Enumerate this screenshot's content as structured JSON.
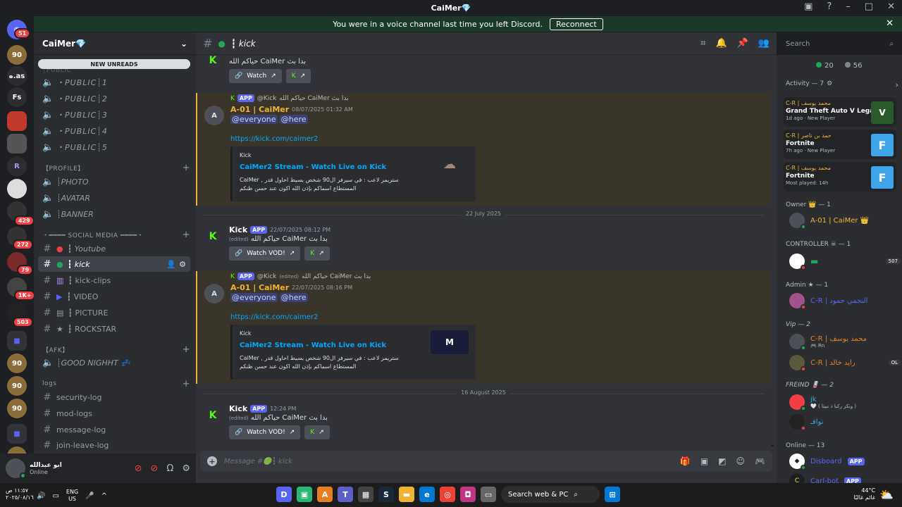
{
  "window": {
    "title": "CaiMer💎"
  },
  "banner": {
    "text": "You were in a voice channel last time you left Discord.",
    "button": "Reconnect"
  },
  "guild_badges": [
    "51",
    "429",
    "272",
    "79",
    "1K+",
    "503"
  ],
  "guild_labels": {
    "g1": "90",
    "g2": "ه.as",
    "g3": "Fs",
    "g4": "R"
  },
  "server": {
    "name": "CaiMer💎",
    "new_unreads": "NEW UNREADS",
    "partial_cat": "┊PUBLIC"
  },
  "channels": {
    "public": [
      " ・PUBLIC┊1",
      " ・PUBLIC┊2",
      " ・PUBLIC┊3",
      " ・PUBLIC┊4",
      " ・PUBLIC┊5"
    ],
    "profile_cat": "【PROFILE】",
    "profile": [
      "┊PHOTO",
      "┊AVATAR",
      "┊BANNER"
    ],
    "social_cat": "・━━━━ SOCIAL MEDIA ━━━━・",
    "social": [
      "┇ Youtube",
      "┇ kick",
      "┇ kick-clips",
      "┇ VIDEO",
      "┇ PICTURE",
      "┇ ROCKSTAR"
    ],
    "afk_cat": "【AFK】",
    "afk": [
      "┊GOOD NIGHHT 💤"
    ],
    "logs_cat": "logs",
    "logs": [
      "security-log",
      "mod-logs",
      "message-log",
      "join-leave-log"
    ]
  },
  "user": {
    "name": "ابو عبدالله",
    "status": "Online"
  },
  "header": {
    "channel": "┇ kick",
    "search_placeholder": "Search"
  },
  "messages": {
    "m0": {
      "text": "حياكم الله CaiMer بدا بث",
      "watch": "Watch"
    },
    "m1": {
      "reply_author": "@Kick",
      "reply_text": "حياكم الله CaiMer بدا بث",
      "app": "APP",
      "author": "A-01 | CaiMer",
      "time": "08/07/2025 01:32 AM",
      "mention1": "@everyone",
      "mention2": "@here",
      "link": "https://kick.com/caimer2",
      "embed_provider": "Kick",
      "embed_title": "CaiMer2 Stream - Watch Live on Kick",
      "embed_desc": "CaiMer , ستريمر لاعب : في سيرفر ال90 شخص بسيط احاول قدر المستطاع اسماكم بإذن الله اكون عند حسن ظنكم"
    },
    "date1": "22 July 2025",
    "m2": {
      "author": "Kick",
      "app": "APP",
      "time": "22/07/2025 08:12 PM",
      "edited": "(edited)",
      "text": "حياكم الله CaiMer بدا بث",
      "watch": "Watch VOD!"
    },
    "m3": {
      "reply_author": "@Kick",
      "reply_edited": "(edited)",
      "reply_text": "حياكم الله CaiMer بدا بث",
      "app": "APP",
      "author": "A-01 | CaiMer",
      "time": "22/07/2025 08:16 PM",
      "mention1": "@everyone",
      "mention2": "@here",
      "link": "https://kick.com/caimer2",
      "embed_provider": "Kick",
      "embed_title": "CaiMer2 Stream - Watch Live on Kick",
      "embed_desc": "CaiMer , ستريمر لاعب : في سيرفر ال90 شخص بسيط احاول قدر المستطاع اسماكم بإذن الله اكون عند حسن ظنكم"
    },
    "date2": "16 August 2025",
    "m4": {
      "author": "Kick",
      "app": "APP",
      "time": "12:24 PM",
      "edited": "(edited)",
      "text": "حياكم الله CaiMer بدا بث",
      "watch": "Watch VOD!"
    }
  },
  "composer": {
    "placeholder": "Message #🟢┇ kick"
  },
  "member_list": {
    "online_count": "20",
    "total_count": "56",
    "activity_head": "Activity — 7",
    "activities": [
      {
        "user": "C-R | محمد يوسف",
        "game": "Grand Theft Auto V Legacy",
        "sub": "1d ago · New Player"
      },
      {
        "user": "C-R | حمد بن ناصر",
        "game": "Fortnite",
        "sub": "7h ago · New Player"
      },
      {
        "user": "C-R | محمد يوسف",
        "game": "Fortnite",
        "sub": "Most played: 14h"
      }
    ],
    "owner_head": "Owner 👑 — 1",
    "owner": "A-01 | CaiMer 👑",
    "controller_head": "CONTROLLER ☠ — 1",
    "controller_badge": "507",
    "admin_head": "Admin ★ — 1",
    "admin": "C-R | النجمي حمود",
    "vip_head": "Vip — 2",
    "vip": [
      {
        "name": "C-R | محمد يوسف",
        "sub": "🎮 Rn"
      },
      {
        "name": "C-R | رايد خالد",
        "badge": "OL"
      }
    ],
    "friend_head": "FREIND 🪫 — 2",
    "friends": [
      {
        "name": "jk",
        "sub": "🤍 ( ونكر ركبا ذ نبيتا )"
      },
      {
        "name": "نوافـ"
      }
    ],
    "online_head": "Online — 13",
    "online": [
      {
        "name": "Disboard",
        "app": "APP"
      },
      {
        "name": "Carl-bot",
        "app": "APP"
      }
    ]
  },
  "taskbar": {
    "time": "١١:٥٧ ص",
    "date": "٢٠٢٥/٠٨/١٦",
    "lang1": "ENG",
    "lang2": "US",
    "search": "Search web & PC",
    "temp": "44°C",
    "weather": "غائم غالبًا"
  },
  "colors": {
    "discord_green": "#23a55a",
    "kick_green": "#53fc18",
    "blurple": "#5865f2",
    "owner_gold": "#f0b232"
  }
}
